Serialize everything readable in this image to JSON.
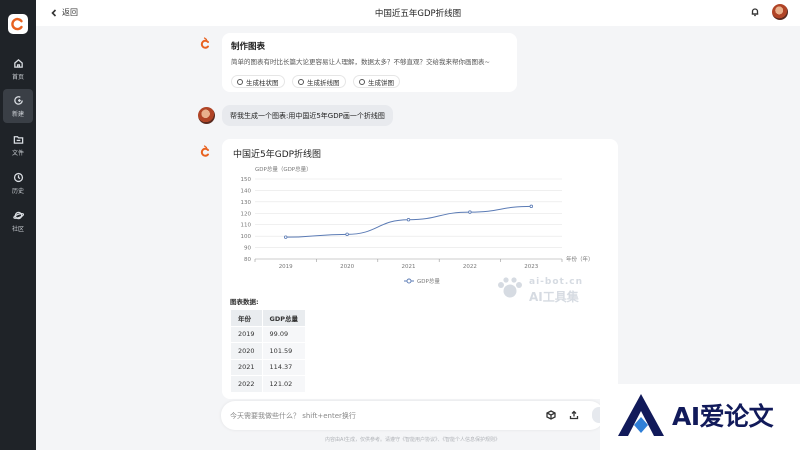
{
  "sidebar": {
    "items": [
      {
        "label": "首页",
        "icon": "home-icon"
      },
      {
        "label": "新建",
        "icon": "new-chat-icon",
        "active": true
      },
      {
        "label": "文件",
        "icon": "folder-icon"
      },
      {
        "label": "历史",
        "icon": "history-icon"
      },
      {
        "label": "社区",
        "icon": "planet-icon"
      }
    ]
  },
  "header": {
    "back_label": "返回",
    "title": "中国近五年GDP折线图"
  },
  "intro_card": {
    "title": "制作图表",
    "text": "简单的图表有时比长篇大论更容易让人理解，数据太多？不够直观？交给我来帮你画图表~",
    "options": [
      "生成柱状图",
      "生成折线图",
      "生成饼图"
    ]
  },
  "user_message": "帮我生成一个图表:用中国近5年GDP画一个折线图",
  "result_card": {
    "title": "中国近5年GDP折线图",
    "table_title": "图表数据:",
    "table_headers": [
      "年份",
      "GDP总量"
    ],
    "table_rows": [
      [
        "2019",
        "99.09"
      ],
      [
        "2020",
        "101.59"
      ],
      [
        "2021",
        "114.37"
      ],
      [
        "2022",
        "121.02"
      ]
    ]
  },
  "chart_data": {
    "type": "line",
    "title": "",
    "ylabel": "GDP总量（GDP总量）",
    "xlabel": "年份（年）",
    "categories": [
      "2019",
      "2020",
      "2021",
      "2022",
      "2023"
    ],
    "series": [
      {
        "name": "GDP总量",
        "values": [
          99.09,
          101.59,
          114.37,
          121.02,
          126.06
        ]
      }
    ],
    "ylim": [
      80,
      150
    ],
    "yticks": [
      "80",
      "90",
      "100",
      "110",
      "120",
      "130",
      "140",
      "150"
    ],
    "grid": true,
    "legend": "bottom-center",
    "color": "#5b7bb5"
  },
  "input": {
    "placeholder": "今天需要我做些什么？ shift+enter换行"
  },
  "disclaimer": "内容由AI生成，仅供参考。请遵守《智能用户协议》、《智能个人信息保护规则》",
  "watermarks": {
    "site_domain": "ai-bot.cn",
    "site_name": "AI工具集",
    "brand": "AI爱论文"
  },
  "colors": {
    "accent": "#e8611f",
    "sidebar_bg": "#1f2328",
    "line": "#5b7bb5"
  }
}
